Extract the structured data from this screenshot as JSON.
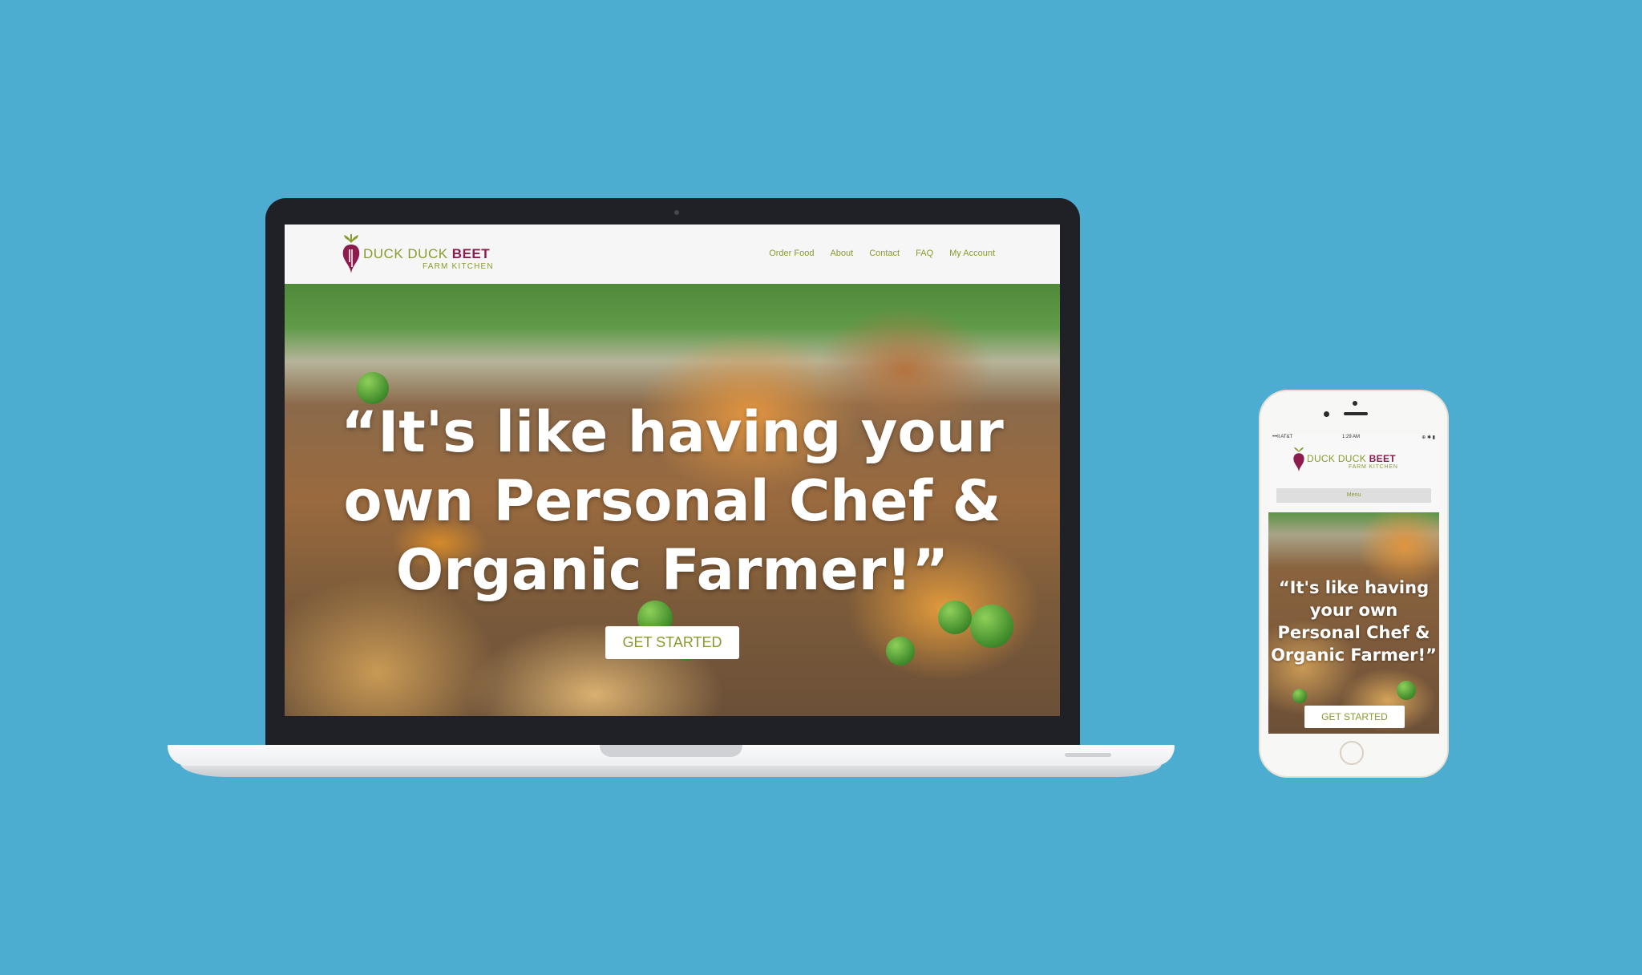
{
  "colors": {
    "background": "#4dadd1",
    "brand_green": "#8a9a2e",
    "brand_beet": "#8c1c4e"
  },
  "site": {
    "logo": {
      "name_part1": "DUCK DUCK ",
      "name_part2": "BEET",
      "tagline": "FARM KITCHEN",
      "icon": "beet-logo-icon"
    },
    "nav": [
      "Order Food",
      "About",
      "Contact",
      "FAQ",
      "My Account"
    ],
    "hero": {
      "headline": "“It's like having your own Personal Chef & Organic Farmer!”",
      "cta_label": "GET STARTED"
    }
  },
  "mobile": {
    "status_bar": {
      "carrier": "•••ll AT&T",
      "time": "1:29 AM",
      "icons": "⊕ ✱ ▮"
    },
    "menu_label": "Menu"
  }
}
